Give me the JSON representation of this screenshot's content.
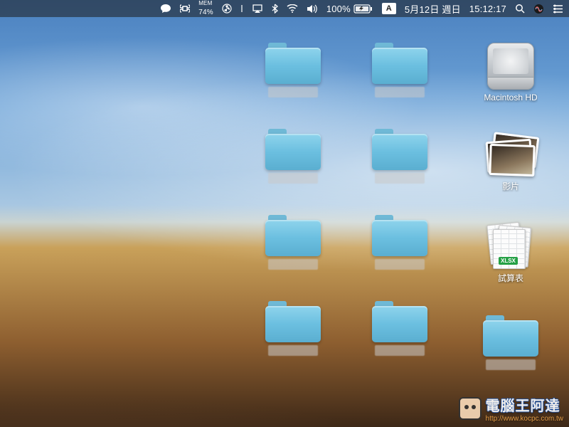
{
  "menubar": {
    "mem_label": "MEM",
    "mem_percent": "74%",
    "battery_percent": "100%",
    "input_method": "A",
    "date": "5月12日 週日",
    "time": "15:12:17"
  },
  "desktop": {
    "col1": [
      {
        "type": "hdd",
        "label": "Macintosh HD"
      },
      {
        "type": "videostack",
        "label": "影片"
      },
      {
        "type": "sheetstack",
        "label": "試算表",
        "badge": "XLSX"
      },
      {
        "type": "folder",
        "label": ""
      }
    ],
    "col2": [
      {
        "type": "folder",
        "label": ""
      },
      {
        "type": "folder",
        "label": ""
      },
      {
        "type": "folder",
        "label": ""
      },
      {
        "type": "folder",
        "label": ""
      }
    ],
    "col3": [
      {
        "type": "folder",
        "label": ""
      },
      {
        "type": "folder",
        "label": ""
      },
      {
        "type": "folder",
        "label": ""
      },
      {
        "type": "folder",
        "label": ""
      }
    ]
  },
  "watermark": {
    "title": "電腦王阿達",
    "subtitle": "http://www.kocpc.com.tw"
  }
}
